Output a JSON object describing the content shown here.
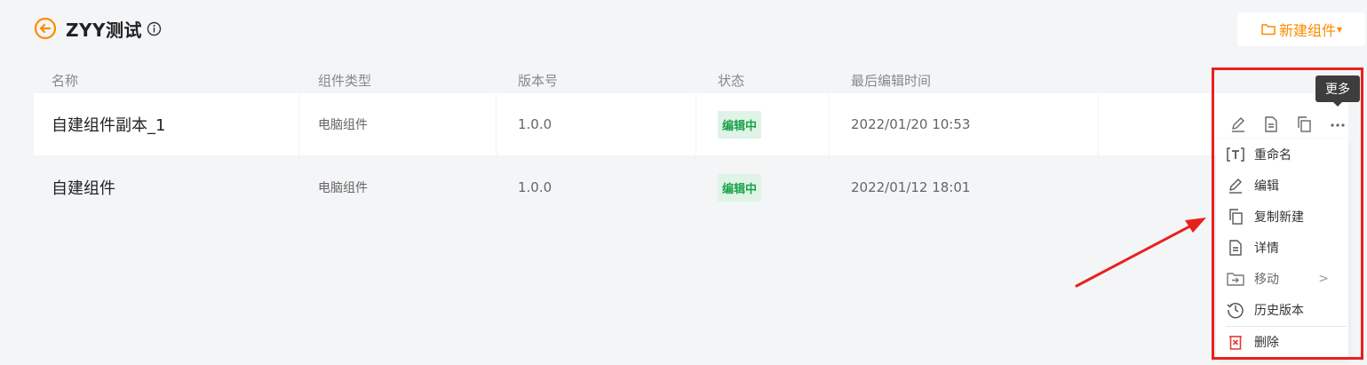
{
  "header": {
    "title": "ZYY测试",
    "new_button_label": "新建组件",
    "new_button_caret": "▾"
  },
  "table": {
    "columns": [
      "名称",
      "组件类型",
      "版本号",
      "状态",
      "最后编辑时间"
    ],
    "rows": [
      {
        "name": "自建组件副本_1",
        "type": "电脑组件",
        "version": "1.0.0",
        "status": "编辑中",
        "last_edited": "2022/01/20 10:53"
      },
      {
        "name": "自建组件",
        "type": "电脑组件",
        "version": "1.0.0",
        "status": "编辑中",
        "last_edited": "2022/01/12 18:01"
      }
    ]
  },
  "tooltip": "更多",
  "more_menu": {
    "items": [
      {
        "label": "重命名",
        "icon": "rename-icon"
      },
      {
        "label": "编辑",
        "icon": "pencil-icon"
      },
      {
        "label": "复制新建",
        "icon": "copy-icon"
      },
      {
        "label": "详情",
        "icon": "document-icon"
      },
      {
        "label": "移动",
        "icon": "folder-move-icon",
        "submenu_arrow": ">"
      },
      {
        "label": "历史版本",
        "icon": "history-icon"
      },
      {
        "label": "删除",
        "icon": "trash-icon"
      }
    ]
  },
  "colors": {
    "accent": "#ff8a00",
    "status_green": "#1aa34a",
    "status_bg": "#dff3e6",
    "highlight_red": "#e8211e",
    "delete_red": "#e53935"
  }
}
